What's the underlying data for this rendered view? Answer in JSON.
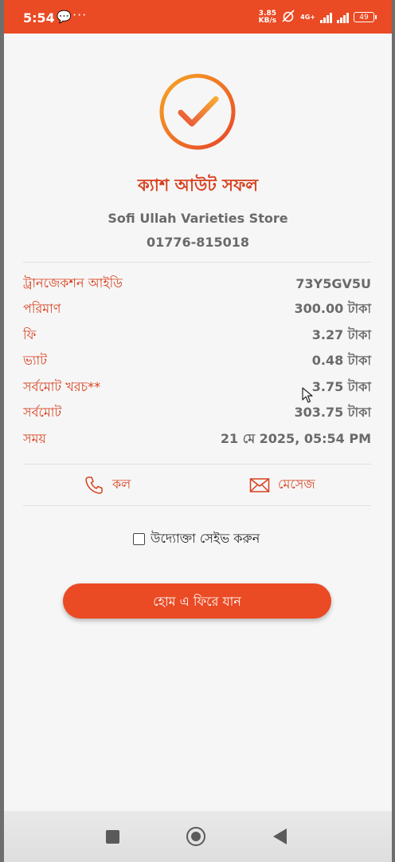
{
  "status_bar": {
    "time": "5:54",
    "net_speed_value": "3.85",
    "net_speed_unit": "KB/s",
    "network_type": "4G+",
    "battery": "49"
  },
  "receipt": {
    "title": "ক্যাশ আউট সফল",
    "merchant_name": "Sofi Ullah Varieties Store",
    "merchant_phone": "01776-815018",
    "details": [
      {
        "label": "ট্রানজেকশন আইডি",
        "value": "73Y5GV5U"
      },
      {
        "label": "পরিমাণ",
        "value": "300.00 টাকা"
      },
      {
        "label": "ফি",
        "value": "3.27 টাকা"
      },
      {
        "label": "ভ্যাট",
        "value": "0.48 টাকা"
      },
      {
        "label": "সর্বমোট খরচ**",
        "value": "3.75 টাকা"
      },
      {
        "label": "সর্বমোট",
        "value": "303.75 টাকা"
      },
      {
        "label": "সময়",
        "value": "21 মে 2025, 05:54 PM"
      }
    ]
  },
  "actions": {
    "call_label": "কল",
    "message_label": "মেসেজ"
  },
  "save_entrepreneur_label": "উদ্যোক্তা সেইভ করুন",
  "home_button_label": "হোম এ ফিরে যান",
  "colors": {
    "brand": "#ea4a24",
    "label": "#d8401f",
    "value": "#6a6a6a"
  }
}
